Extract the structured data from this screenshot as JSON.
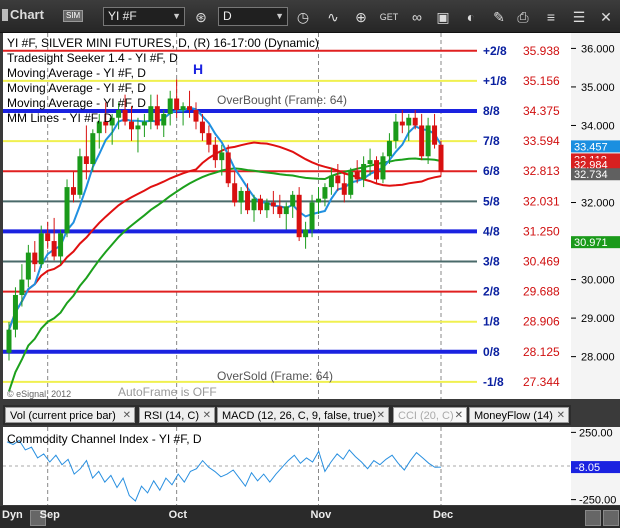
{
  "toolbar": {
    "app_label": "Chart",
    "sim_badge": "SIM",
    "symbol": "YI #F",
    "interval": "D"
  },
  "legend": [
    "YI #F, SILVER MINI FUTURES, D, (R) 16-17:00 (Dynamic)",
    "Tradesight Seeker 1.4 - YI #F, D",
    "Moving Average - YI #F, D",
    "Moving Average - YI #F, D",
    "Moving Average - YI #F, D",
    "MM Lines - YI #F, D"
  ],
  "annotations": {
    "high_marker": "H",
    "overbought": "OverBought (Frame: 64)",
    "oversold": "OverSold (Frame: 64)",
    "autoframe": "AutoFrame is OFF",
    "copyright": "© eSignal, 2012"
  },
  "chart_data": {
    "type": "candlestick",
    "ylim": [
      26.9,
      36.4
    ],
    "murrey_lines": [
      {
        "label": "+2/8",
        "value": 35.938,
        "color": "#e02020"
      },
      {
        "label": "+1/8",
        "value": 35.156,
        "color": "#f0f050"
      },
      {
        "label": "8/8",
        "value": 34.375,
        "color": "#1a22e0"
      },
      {
        "label": "7/8",
        "value": 33.594,
        "color": "#f0f050"
      },
      {
        "label": "6/8",
        "value": 32.813,
        "color": "#e02020"
      },
      {
        "label": "5/8",
        "value": 32.031,
        "color": "#4a6a6a"
      },
      {
        "label": "4/8",
        "value": 31.25,
        "color": "#1a22e0"
      },
      {
        "label": "3/8",
        "value": 30.469,
        "color": "#4a6a6a"
      },
      {
        "label": "2/8",
        "value": 29.688,
        "color": "#e02020"
      },
      {
        "label": "1/8",
        "value": 28.906,
        "color": "#f0f050"
      },
      {
        "label": "0/8",
        "value": 28.125,
        "color": "#1a22e0"
      },
      {
        "label": "-1/8",
        "value": 27.344,
        "color": "#f0f050"
      }
    ],
    "price_ticks": [
      36.0,
      35.0,
      34.0,
      33.0,
      32.0,
      31.0,
      30.0,
      29.0,
      28.0
    ],
    "price_badges": [
      {
        "value": 33.457,
        "color": "#1a8fe0"
      },
      {
        "value": 33.118,
        "color": "#d82020"
      },
      {
        "value": 32.984,
        "color": "#d82020"
      },
      {
        "value": 32.734,
        "color": "#606060"
      },
      {
        "value": 30.971,
        "color": "#1a9a1a"
      }
    ],
    "x_labels": [
      {
        "label": "Sep",
        "index": 6
      },
      {
        "label": "Oct",
        "index": 26
      },
      {
        "label": "Nov",
        "index": 48
      },
      {
        "label": "Dec",
        "index": 67
      }
    ],
    "candles": [
      [
        28.1,
        28.9,
        27.9,
        28.7
      ],
      [
        28.7,
        29.8,
        28.5,
        29.6
      ],
      [
        29.6,
        30.4,
        29.3,
        30.0
      ],
      [
        30.0,
        30.9,
        29.8,
        30.7
      ],
      [
        30.7,
        31.0,
        30.2,
        30.4
      ],
      [
        30.4,
        31.4,
        30.3,
        31.2
      ],
      [
        31.2,
        31.5,
        30.8,
        31.0
      ],
      [
        31.0,
        31.6,
        30.5,
        30.6
      ],
      [
        30.6,
        31.3,
        30.4,
        31.2
      ],
      [
        31.2,
        32.6,
        31.1,
        32.4
      ],
      [
        32.4,
        32.8,
        32.0,
        32.2
      ],
      [
        32.2,
        33.4,
        32.1,
        33.2
      ],
      [
        33.2,
        34.0,
        32.6,
        33.0
      ],
      [
        33.0,
        33.9,
        32.8,
        33.8
      ],
      [
        33.8,
        34.3,
        33.4,
        34.1
      ],
      [
        34.1,
        34.6,
        33.8,
        34.0
      ],
      [
        34.0,
        34.3,
        33.5,
        34.2
      ],
      [
        34.2,
        34.6,
        33.9,
        34.4
      ],
      [
        34.4,
        34.8,
        34.0,
        34.1
      ],
      [
        34.1,
        34.5,
        33.6,
        33.9
      ],
      [
        33.9,
        34.2,
        33.3,
        34.0
      ],
      [
        34.0,
        34.3,
        33.7,
        34.1
      ],
      [
        34.1,
        34.8,
        33.9,
        34.5
      ],
      [
        34.5,
        34.8,
        33.9,
        34.0
      ],
      [
        34.0,
        34.4,
        33.7,
        34.3
      ],
      [
        34.3,
        34.9,
        34.0,
        34.7
      ],
      [
        34.7,
        35.2,
        34.2,
        34.4
      ],
      [
        34.4,
        34.6,
        34.0,
        34.5
      ],
      [
        34.5,
        34.9,
        34.2,
        34.4
      ],
      [
        34.4,
        34.6,
        33.9,
        34.1
      ],
      [
        34.1,
        34.3,
        33.6,
        33.8
      ],
      [
        33.8,
        34.0,
        33.3,
        33.5
      ],
      [
        33.5,
        33.7,
        32.9,
        33.1
      ],
      [
        33.1,
        33.5,
        32.7,
        33.3
      ],
      [
        33.3,
        33.5,
        32.4,
        32.5
      ],
      [
        32.5,
        32.8,
        31.9,
        32.0
      ],
      [
        32.0,
        32.4,
        31.7,
        32.3
      ],
      [
        32.3,
        32.5,
        31.7,
        31.8
      ],
      [
        31.8,
        32.2,
        31.5,
        32.1
      ],
      [
        32.1,
        32.2,
        31.7,
        31.8
      ],
      [
        31.8,
        32.1,
        31.6,
        32.0
      ],
      [
        32.0,
        32.3,
        31.7,
        31.9
      ],
      [
        31.9,
        32.2,
        31.6,
        31.7
      ],
      [
        31.7,
        32.0,
        31.3,
        31.9
      ],
      [
        31.9,
        32.3,
        31.6,
        32.2
      ],
      [
        32.2,
        32.4,
        31.0,
        31.1
      ],
      [
        31.1,
        31.5,
        30.8,
        31.3
      ],
      [
        31.3,
        32.2,
        31.1,
        32.0
      ],
      [
        32.0,
        32.4,
        31.7,
        32.1
      ],
      [
        32.1,
        32.5,
        31.9,
        32.4
      ],
      [
        32.4,
        32.9,
        32.2,
        32.7
      ],
      [
        32.7,
        33.0,
        32.3,
        32.5
      ],
      [
        32.5,
        32.8,
        32.0,
        32.2
      ],
      [
        32.2,
        32.9,
        32.1,
        32.8
      ],
      [
        32.8,
        33.1,
        32.5,
        32.6
      ],
      [
        32.6,
        33.2,
        32.4,
        33.0
      ],
      [
        33.0,
        33.4,
        32.7,
        33.1
      ],
      [
        33.1,
        33.2,
        32.5,
        32.6
      ],
      [
        32.6,
        33.3,
        32.5,
        33.2
      ],
      [
        33.2,
        33.8,
        33.0,
        33.6
      ],
      [
        33.6,
        34.3,
        33.4,
        34.1
      ],
      [
        34.1,
        34.4,
        33.8,
        34.0
      ],
      [
        34.0,
        34.3,
        33.6,
        34.2
      ],
      [
        34.2,
        34.4,
        33.9,
        34.0
      ],
      [
        34.0,
        34.3,
        33.1,
        33.2
      ],
      [
        33.2,
        34.2,
        33.0,
        34.0
      ],
      [
        34.0,
        34.3,
        33.4,
        33.5
      ],
      [
        33.5,
        33.6,
        32.7,
        32.8
      ]
    ],
    "cci_ticks": [
      250.0,
      -250.0
    ],
    "cci_value": -8.05,
    "cci_series": [
      180,
      160,
      190,
      120,
      140,
      60,
      90,
      30,
      80,
      10,
      50,
      -60,
      -20,
      40,
      -90,
      -40,
      -120,
      -70,
      -160,
      -90,
      -220,
      -260,
      -150,
      -200,
      -110,
      -180,
      -90,
      -140,
      -60,
      -120,
      -40,
      -20,
      40,
      -10,
      -40,
      -80,
      -60,
      -30,
      -90,
      -150,
      -50,
      -110,
      -60,
      -120,
      -60,
      -10,
      40,
      80,
      20,
      60,
      30,
      110,
      -40,
      30,
      90,
      50,
      120,
      70,
      30,
      -20,
      40,
      10,
      50,
      80,
      20,
      -30,
      40,
      100,
      60,
      20,
      -10,
      -8
    ]
  },
  "tabs": [
    {
      "label": "Vol (current price bar)"
    },
    {
      "label": "RSI (14, C)"
    },
    {
      "label": "MACD (12, 26, C, 9, false, true)"
    },
    {
      "label": "CCI (20, C)"
    },
    {
      "label": "MoneyFlow (14)"
    }
  ],
  "cci_title": "Commodity Channel Index - YI #F, D",
  "statusbar": {
    "dyn": "Dyn"
  }
}
